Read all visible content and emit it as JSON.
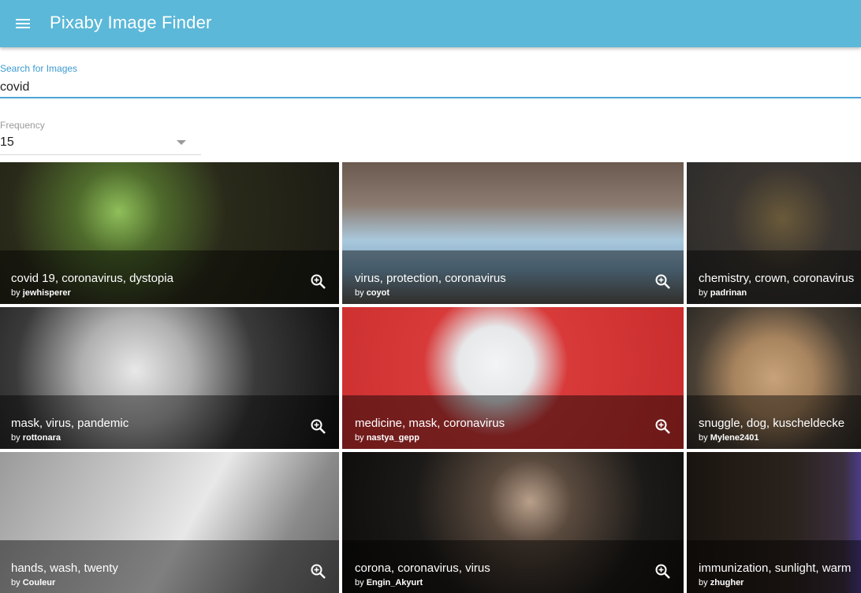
{
  "app": {
    "title": "Pixaby Image Finder",
    "menu_icon": "menu-icon"
  },
  "search": {
    "label": "Search for Images",
    "value": "covid"
  },
  "frequency": {
    "label": "Frequency",
    "value": "15"
  },
  "colors": {
    "appbar": "#5bb8d8",
    "accent": "#4aa3d6"
  },
  "images": [
    {
      "tags": "covid 19, coronavirus, dystopia",
      "by": "by",
      "user": "jewhisperer"
    },
    {
      "tags": "virus, protection, coronavirus",
      "by": "by",
      "user": "coyot"
    },
    {
      "tags": "chemistry, crown, coronavirus",
      "by": "by",
      "user": "padrinan"
    },
    {
      "tags": "mask, virus, pandemic",
      "by": "by",
      "user": "rottonara"
    },
    {
      "tags": "medicine, mask, coronavirus",
      "by": "by",
      "user": "nastya_gepp"
    },
    {
      "tags": "snuggle, dog, kuscheldecke",
      "by": "by",
      "user": "Mylene2401"
    },
    {
      "tags": "hands, wash, twenty",
      "by": "by",
      "user": "Couleur"
    },
    {
      "tags": "corona, coronavirus, virus",
      "by": "by",
      "user": "Engin_Akyurt"
    },
    {
      "tags": "immunization, sunlight, warm",
      "by": "by",
      "user": "zhugher"
    }
  ],
  "zoom_icon": "zoom-in-icon"
}
